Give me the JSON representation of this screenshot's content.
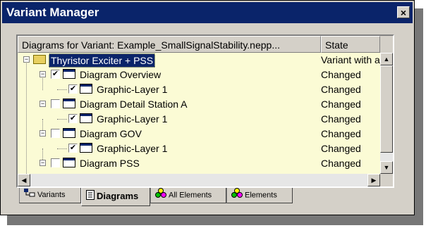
{
  "window": {
    "title": "Variant Manager",
    "close_symbol": "×"
  },
  "columns": {
    "diagrams": "Diagrams for Variant: Example_SmallSignalStability.nepp...",
    "state": "State"
  },
  "rows": [
    {
      "label": "Thyristor Exciter + PSS",
      "state": "Variant with a",
      "checkbox": null,
      "expander": "−",
      "icon": "folder-icon",
      "selected": true
    },
    {
      "label": "Diagram Overview",
      "state": "Changed",
      "checkbox": "✔",
      "expander": "−",
      "icon": "diagram-icon",
      "selected": false
    },
    {
      "label": "Graphic-Layer 1",
      "state": "Changed",
      "checkbox": "✔",
      "expander": null,
      "icon": "diagram-icon",
      "selected": false
    },
    {
      "label": "Diagram Detail Station A",
      "state": "Changed",
      "checkbox": "",
      "expander": "−",
      "icon": "diagram-icon",
      "selected": false
    },
    {
      "label": "Graphic-Layer 1",
      "state": "Changed",
      "checkbox": "✔",
      "expander": null,
      "icon": "diagram-icon",
      "selected": false
    },
    {
      "label": "Diagram GOV",
      "state": "Changed",
      "checkbox": "",
      "expander": "−",
      "icon": "diagram-icon",
      "selected": false
    },
    {
      "label": "Graphic-Layer 1",
      "state": "Changed",
      "checkbox": "✔",
      "expander": null,
      "icon": "diagram-icon",
      "selected": false
    },
    {
      "label": "Diagram PSS",
      "state": "Changed",
      "checkbox": "",
      "expander": "−",
      "icon": "diagram-icon",
      "selected": false
    }
  ],
  "scroll": {
    "up": "▲",
    "down": "▼",
    "left": "◀",
    "right": "▶"
  },
  "tabs": [
    {
      "label": "Variants",
      "icon": "variants-icon",
      "active": false
    },
    {
      "label": "Diagrams",
      "icon": "diagrams-icon",
      "active": true
    },
    {
      "label": "All Elements",
      "icon": "all-elements-icon",
      "active": false
    },
    {
      "label": "Elements",
      "icon": "elements-icon",
      "active": false
    }
  ]
}
